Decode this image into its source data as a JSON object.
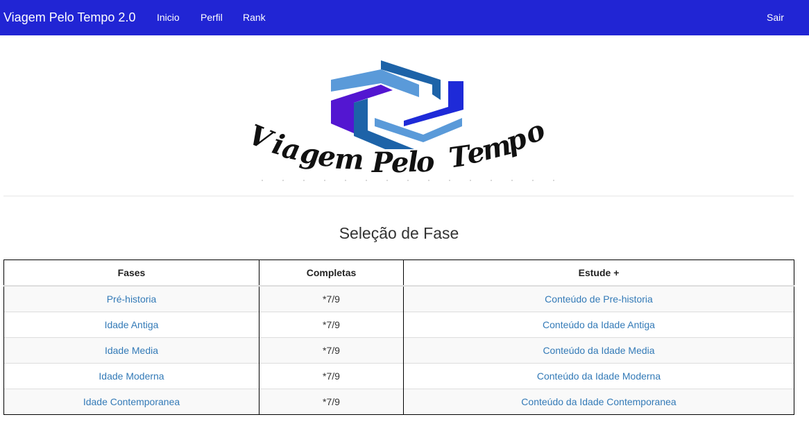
{
  "navbar": {
    "brand": "Viagem Pelo Tempo 2.0",
    "links": [
      "Inicio",
      "Perfil",
      "Rank"
    ],
    "logout": "Sair",
    "background": "#2125d4"
  },
  "logo": {
    "text": "Viagem Pelo Tempo",
    "colors": [
      "#1d63a8",
      "#5a9ad9",
      "#5316d1",
      "#1e2ad8"
    ]
  },
  "section_title": "Seleção de Fase",
  "table": {
    "headers": [
      "Fases",
      "Completas",
      "Estude +"
    ],
    "rows": [
      {
        "phase": "Pré-historia",
        "completed": "*7/9",
        "study": "Conteúdo de Pre-historia"
      },
      {
        "phase": "Idade Antiga",
        "completed": "*7/9",
        "study": "Conteúdo da Idade Antiga"
      },
      {
        "phase": "Idade Media",
        "completed": "*7/9",
        "study": "Conteúdo da Idade Media"
      },
      {
        "phase": "Idade Moderna",
        "completed": "*7/9",
        "study": "Conteúdo da Idade Moderna"
      },
      {
        "phase": "Idade Contemporanea",
        "completed": "*7/9",
        "study": "Conteúdo da Idade Contemporanea"
      }
    ],
    "link_color": "#337ab7"
  }
}
